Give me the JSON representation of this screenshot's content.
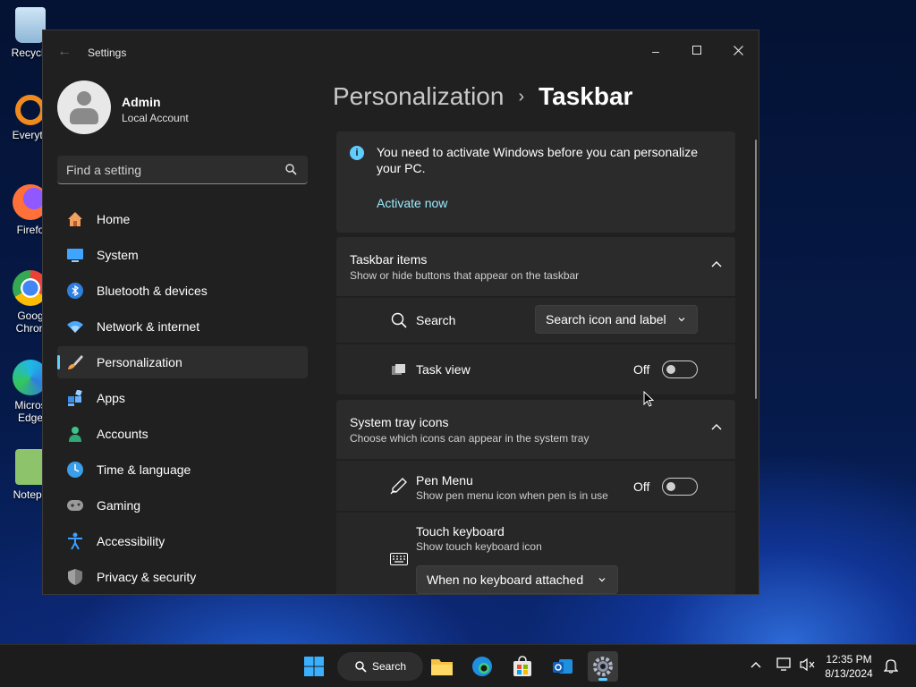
{
  "desktop": {
    "icons": [
      {
        "label": "Recycle",
        "icon": "recycle-bin-icon"
      },
      {
        "label": "Everyth",
        "icon": "everything-search-icon"
      },
      {
        "label": "Firefo",
        "icon": "firefox-icon"
      },
      {
        "label": "Goog Chron",
        "icon": "chrome-icon"
      },
      {
        "label": "Micros Edge",
        "icon": "edge-icon"
      },
      {
        "label": "Notepa",
        "icon": "notepad-icon"
      }
    ]
  },
  "window": {
    "title": "Settings",
    "controls": {
      "minimize": "–",
      "maximize": "☐",
      "close": "✕"
    }
  },
  "user": {
    "name": "Admin",
    "account_type": "Local Account"
  },
  "search": {
    "placeholder": "Find a setting"
  },
  "sidebar": {
    "items": [
      {
        "label": "Home",
        "icon": "home-icon"
      },
      {
        "label": "System",
        "icon": "system-icon"
      },
      {
        "label": "Bluetooth & devices",
        "icon": "bluetooth-icon"
      },
      {
        "label": "Network & internet",
        "icon": "network-icon"
      },
      {
        "label": "Personalization",
        "icon": "personalization-icon",
        "active": true
      },
      {
        "label": "Apps",
        "icon": "apps-icon"
      },
      {
        "label": "Accounts",
        "icon": "accounts-icon"
      },
      {
        "label": "Time & language",
        "icon": "time-language-icon"
      },
      {
        "label": "Gaming",
        "icon": "gaming-icon"
      },
      {
        "label": "Accessibility",
        "icon": "accessibility-icon"
      },
      {
        "label": "Privacy & security",
        "icon": "privacy-icon"
      }
    ]
  },
  "breadcrumb": {
    "parent": "Personalization",
    "separator": "›",
    "current": "Taskbar"
  },
  "activation": {
    "message": "You need to activate Windows before you can personalize your PC.",
    "link": "Activate now"
  },
  "taskbar_items": {
    "title": "Taskbar items",
    "description": "Show or hide buttons that appear on the taskbar",
    "search": {
      "label": "Search",
      "value": "Search icon and label"
    },
    "task_view": {
      "label": "Task view",
      "state": "Off"
    }
  },
  "system_tray_icons": {
    "title": "System tray icons",
    "description": "Choose which icons can appear in the system tray",
    "pen_menu": {
      "label": "Pen Menu",
      "description": "Show pen menu icon when pen is in use",
      "state": "Off"
    },
    "touch_keyboard": {
      "label": "Touch keyboard",
      "description": "Show touch keyboard icon",
      "value": "When no keyboard attached"
    }
  },
  "taskbar": {
    "search_label": "Search",
    "time": "12:35 PM",
    "date": "8/13/2024"
  },
  "colors": {
    "accent": "#60cdff",
    "link": "#99ebff",
    "window_bg": "#202020",
    "card_bg": "#2b2b2b"
  }
}
